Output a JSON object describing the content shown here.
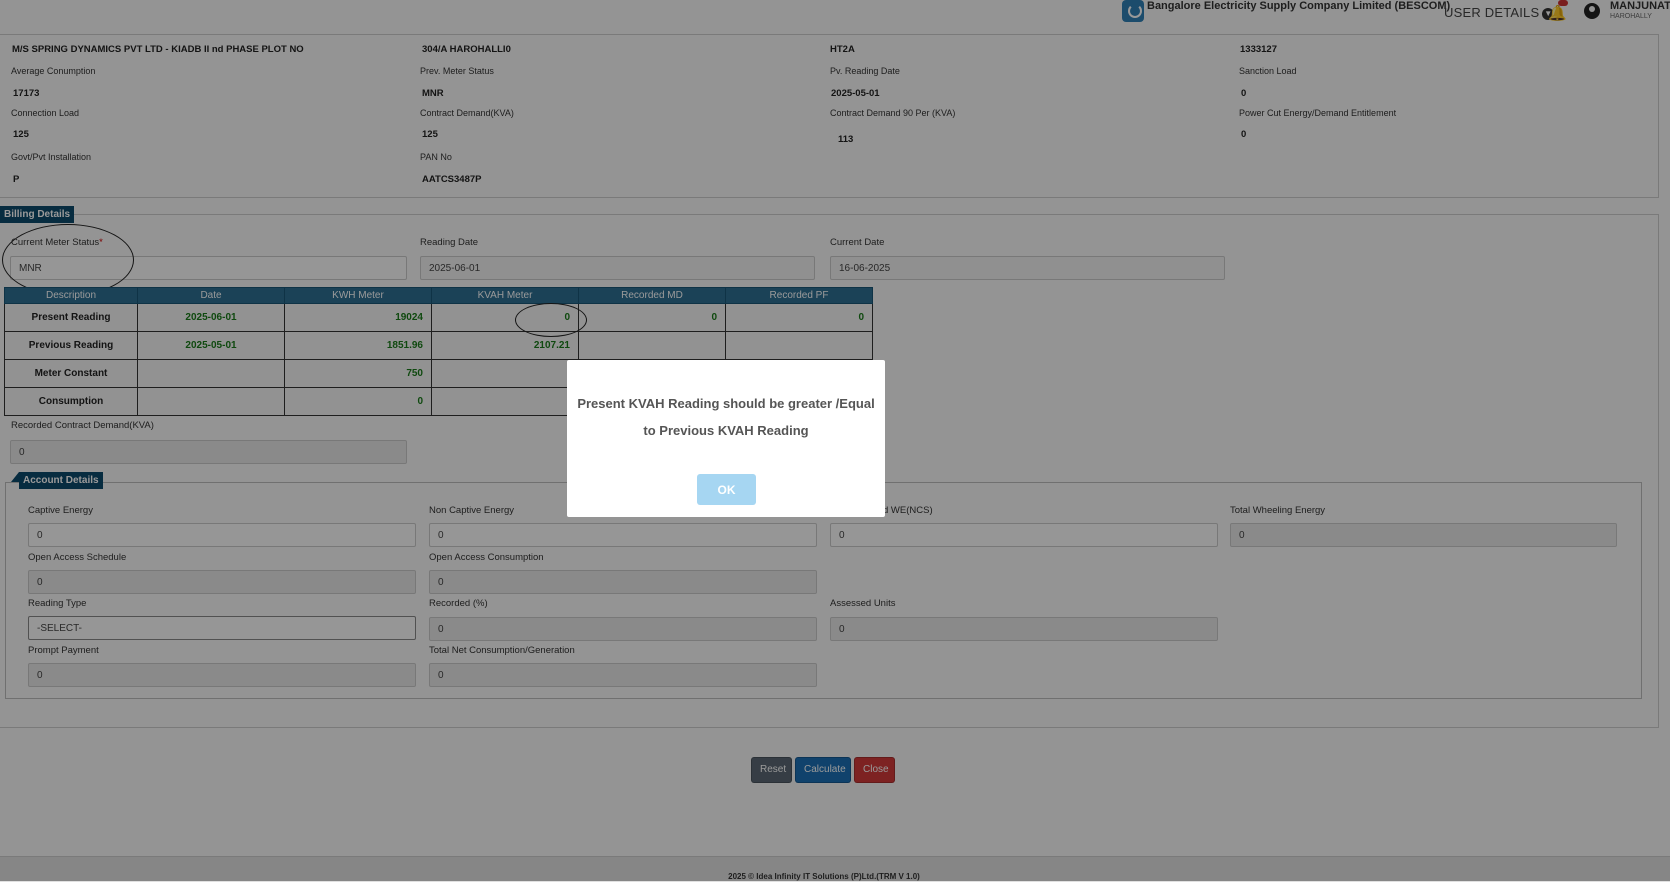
{
  "header": {
    "company": "Bangalore Electricity Supply Company Limited (BESCOM)",
    "user_details_label": "USER DETAILS",
    "user_name": "MANJUNATH",
    "user_location": "HAROHALLY",
    "icons": {
      "logo": "bescom-logo",
      "chevron": "chevron-down-icon",
      "bell": "bell-icon",
      "avatar": "user-avatar-icon"
    }
  },
  "consumer": {
    "name": "M/S SPRING DYNAMICS PVT LTD - KIADB II nd PHASE PLOT NO",
    "address": "304/A HAROHALLI0",
    "tariff": "HT2A",
    "account_no": "1333127",
    "fields": [
      {
        "label": "Average Conumption",
        "value": "17173"
      },
      {
        "label": "Prev. Meter Status",
        "value": "MNR"
      },
      {
        "label": "Pv. Reading Date",
        "value": "2025-05-01"
      },
      {
        "label": "Sanction Load",
        "value": "0"
      },
      {
        "label": "Connection Load",
        "value": "125"
      },
      {
        "label": "Contract Demand(KVA)",
        "value": "125"
      },
      {
        "label": "Contract Demand 90 Per (KVA)",
        "value": "113"
      },
      {
        "label": "Power Cut Energy/Demand Entitlement",
        "value": "0"
      },
      {
        "label": "Govt/Pvt Installation",
        "value": "P"
      },
      {
        "label": "PAN No",
        "value": "AATCS3487P"
      }
    ]
  },
  "billing": {
    "section_title": "Billing Details",
    "current_meter_status_label": "Current Meter Status",
    "required_mark": "*",
    "current_meter_status_value": "MNR",
    "reading_date_label": "Reading Date",
    "reading_date_value": "2025-06-01",
    "current_date_label": "Current Date",
    "current_date_value": "16-06-2025",
    "table": {
      "headers": [
        "Description",
        "Date",
        "KWH Meter",
        "KVAH Meter",
        "Recorded MD",
        "Recorded PF"
      ],
      "rows": [
        [
          "Present Reading",
          "2025-06-01",
          "19024",
          "0",
          "0",
          "0"
        ],
        [
          "Previous Reading",
          "2025-05-01",
          "1851.96",
          "2107.21",
          "",
          ""
        ],
        [
          "Meter Constant",
          "",
          "750",
          "",
          "",
          ""
        ],
        [
          "Consumption",
          "",
          "0",
          "",
          "",
          ""
        ]
      ]
    },
    "recorded_cd_label": "Recorded Contract Demand(KVA)",
    "recorded_cd_value": "0"
  },
  "account": {
    "section_title": "Account Details",
    "fields": [
      {
        "label": "Captive Energy",
        "value": "0"
      },
      {
        "label": "Non Captive Energy",
        "value": "0"
      },
      {
        "label": "d WE(NCS)",
        "value": "0"
      },
      {
        "label": "Total Wheeling Energy",
        "value": "0"
      },
      {
        "label": "Open Access Schedule",
        "value": "0"
      },
      {
        "label": "Open Access Consumption",
        "value": "0"
      },
      {
        "label": "Reading Type",
        "value": "-SELECT-"
      },
      {
        "label": "Recorded (%)",
        "value": "0"
      },
      {
        "label": "Assessed Units",
        "value": "0"
      },
      {
        "label": "Prompt Payment",
        "value": "0"
      },
      {
        "label": "Total Net Consumption/Generation",
        "value": "0"
      }
    ]
  },
  "actions": {
    "reset": "Reset",
    "calculate": "Calculate",
    "close": "Close"
  },
  "footer": {
    "text": "2025 © Idea Infinity IT Solutions (P)Ltd.(TRM V 1.0)"
  },
  "modal": {
    "message": "Present KVAH Reading should be greater /Equal to Previous KVAH Reading",
    "ok_label": "OK"
  }
}
